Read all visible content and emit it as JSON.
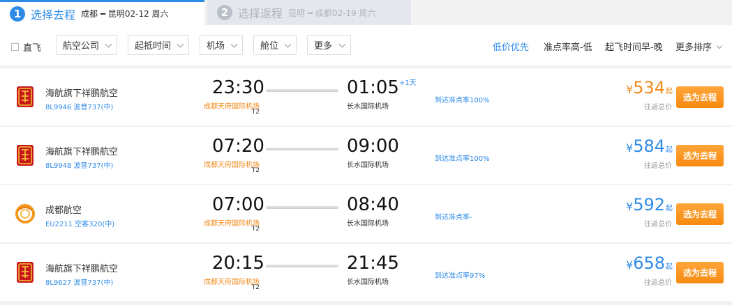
{
  "steps": [
    {
      "num": "1",
      "title": "选择去程",
      "route": "成都 ━ 昆明02-12 周六"
    },
    {
      "num": "2",
      "title": "选择返程",
      "route": "昆明 ━ 成都02-19 周六"
    }
  ],
  "filters": {
    "direct_label": "直飞",
    "dropdowns": [
      "航空公司",
      "起抵时间",
      "机场",
      "舱位",
      "更多"
    ]
  },
  "sorts": [
    "低价优先",
    "准点率高-低",
    "起飞时间早-晚",
    "更多排序"
  ],
  "colors": {
    "accent": "#2f8be8",
    "orange": "#f18a1b",
    "button": "#f78a10"
  },
  "flights": [
    {
      "logo": "xiangpeng-logo",
      "airline": "海航旗下祥鹏航空",
      "flight_no": "8L9946 波音737(中)",
      "dep_time": "23:30",
      "dep_airport": "成都天府国际机场",
      "dep_terminal": "T2",
      "arr_time": "01:05",
      "plus_day": "+1天",
      "arr_airport": "长水国际机场",
      "ontime": "到达准点率100%",
      "price_symbol": "¥",
      "price": "534",
      "price_suffix": "起",
      "price_label": "往返总价",
      "button": "选为去程"
    },
    {
      "logo": "xiangpeng-logo",
      "airline": "海航旗下祥鹏航空",
      "flight_no": "8L9948 波音737(中)",
      "dep_time": "07:20",
      "dep_airport": "成都天府国际机场",
      "dep_terminal": "T2",
      "arr_time": "09:00",
      "plus_day": "",
      "arr_airport": "长水国际机场",
      "ontime": "到达准点率100%",
      "price_symbol": "¥",
      "price": "584",
      "price_suffix": "起",
      "price_label": "往返总价",
      "button": "选为去程"
    },
    {
      "logo": "chengdu-airlines-logo",
      "airline": "成都航空",
      "flight_no": "EU2211 空客320(中)",
      "dep_time": "07:00",
      "dep_airport": "成都天府国际机场",
      "dep_terminal": "T2",
      "arr_time": "08:40",
      "plus_day": "",
      "arr_airport": "长水国际机场",
      "ontime": "到达准点率-",
      "price_symbol": "¥",
      "price": "592",
      "price_suffix": "起",
      "price_label": "往返总价",
      "button": "选为去程"
    },
    {
      "logo": "xiangpeng-logo",
      "airline": "海航旗下祥鹏航空",
      "flight_no": "8L9627 波音737(中)",
      "dep_time": "20:15",
      "dep_airport": "成都天府国际机场",
      "dep_terminal": "T2",
      "arr_time": "21:45",
      "plus_day": "",
      "arr_airport": "长水国际机场",
      "ontime": "到达准点率97%",
      "price_symbol": "¥",
      "price": "658",
      "price_suffix": "起",
      "price_label": "往返总价",
      "button": "选为去程"
    }
  ]
}
